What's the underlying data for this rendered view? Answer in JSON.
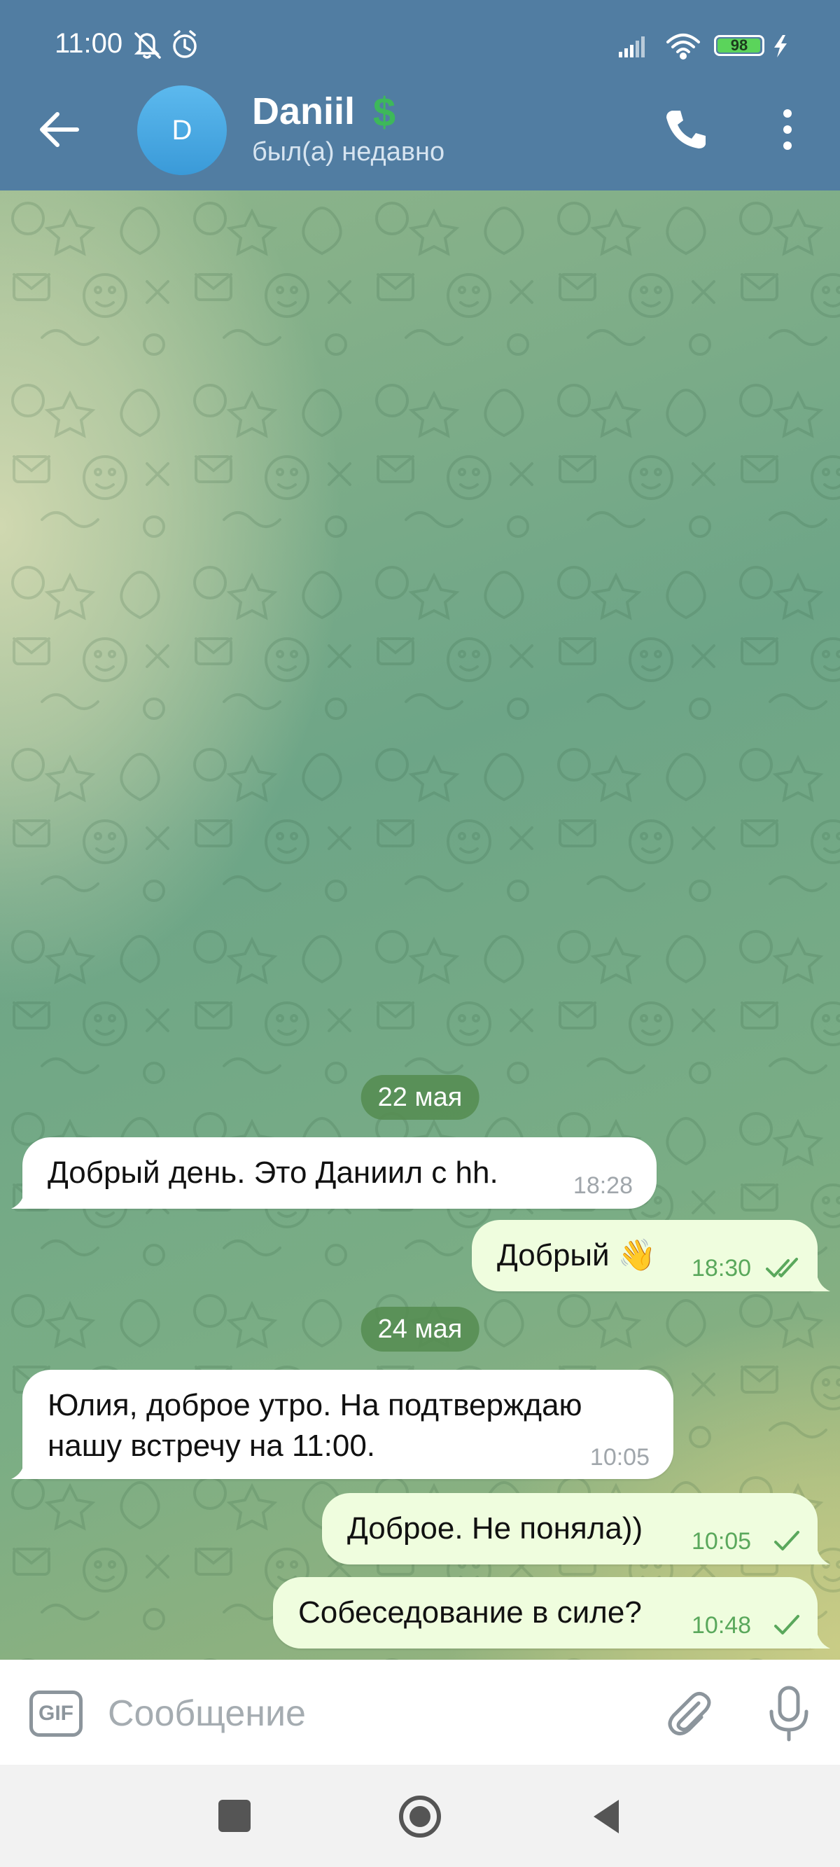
{
  "status_bar": {
    "time": "11:00",
    "battery": "98",
    "battery_level": 0.98
  },
  "header": {
    "avatar_letter": "D",
    "contact_name": "Daniil",
    "contact_status": "был(а) недавно"
  },
  "chat": {
    "dates": [
      "22 мая",
      "24 мая"
    ],
    "messages": [
      {
        "direction": "in",
        "text": "Добрый день. Это Даниил с hh.",
        "time": "18:28"
      },
      {
        "direction": "out",
        "text": "Добрый 👋",
        "time": "18:30",
        "status": "read"
      },
      {
        "direction": "in",
        "text": "Юлия, доброе утро. На подтверждаю\nнашу встречу на 11:00.",
        "time": "10:05"
      },
      {
        "direction": "out",
        "text": "Доброе. Не поняла))",
        "time": "10:05",
        "status": "sent"
      },
      {
        "direction": "out",
        "text": "Собеседование в силе?",
        "time": "10:48",
        "status": "sent"
      }
    ]
  },
  "input": {
    "gif_label": "GIF",
    "placeholder": "Сообщение"
  },
  "colors": {
    "header": "#517da2",
    "incoming_bubble": "#ffffff",
    "outgoing_bubble": "#effdde",
    "date_chip": "#5a8c50"
  }
}
